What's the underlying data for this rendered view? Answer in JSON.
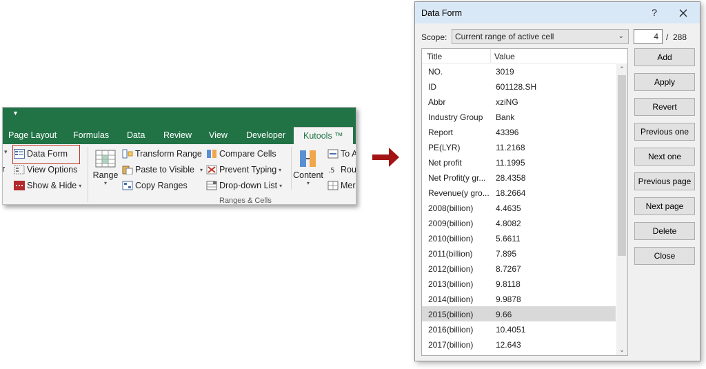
{
  "ribbon": {
    "tabs": [
      "Page Layout",
      "Formulas",
      "Data",
      "Review",
      "View",
      "Developer",
      "Kutools ™"
    ],
    "col1": [
      "Data Form",
      "View Options",
      "Show & Hide"
    ],
    "range_label": "Range",
    "col2": [
      "Transform Range",
      "Paste to Visible",
      "Copy Ranges"
    ],
    "col3": [
      "Compare Cells",
      "Prevent Typing",
      "Drop-down List"
    ],
    "content_label": "Content",
    "col4": [
      "To A",
      "Rou",
      "Mer"
    ],
    "group_label": "Ranges & Cells",
    "cut_text": "r",
    "accent": "#217346",
    "highlight_border": "#c0392b"
  },
  "arrow": {
    "color": "#a31515"
  },
  "dialog": {
    "title": "Data Form",
    "help": "?",
    "scope_label": "Scope:",
    "scope_value": "Current range of active cell",
    "record_current": "4",
    "record_sep": "/",
    "record_total": "288",
    "headers": [
      "Title",
      "Value"
    ],
    "rows": [
      [
        "NO.",
        "3019"
      ],
      [
        "ID",
        "601128.SH"
      ],
      [
        "Abbr",
        "xziNG"
      ],
      [
        "Industry Group",
        "Bank"
      ],
      [
        "Report",
        "43396"
      ],
      [
        "PE(LYR)",
        "11.2168"
      ],
      [
        "Net profit",
        "11.1995"
      ],
      [
        "Net Profit(y gr...",
        "28.4358"
      ],
      [
        "Revenue(y gro...",
        "18.2664"
      ],
      [
        "2008(billion)",
        "4.4635"
      ],
      [
        "2009(billion)",
        "4.8082"
      ],
      [
        "2010(billion)",
        "5.6611"
      ],
      [
        "2011(billion)",
        "7.895"
      ],
      [
        "2012(billion)",
        "8.7267"
      ],
      [
        "2013(billion)",
        "9.8118"
      ],
      [
        "2014(billion)",
        "9.9878"
      ],
      [
        "2015(billion)",
        "9.66"
      ],
      [
        "2016(billion)",
        "10.4051"
      ],
      [
        "2017(billion)",
        "12.643"
      ]
    ],
    "selected_row": 16,
    "buttons": [
      "Add",
      "Apply",
      "Revert",
      "Previous one",
      "Next one",
      "Previous page",
      "Next page",
      "Delete",
      "Close"
    ]
  }
}
